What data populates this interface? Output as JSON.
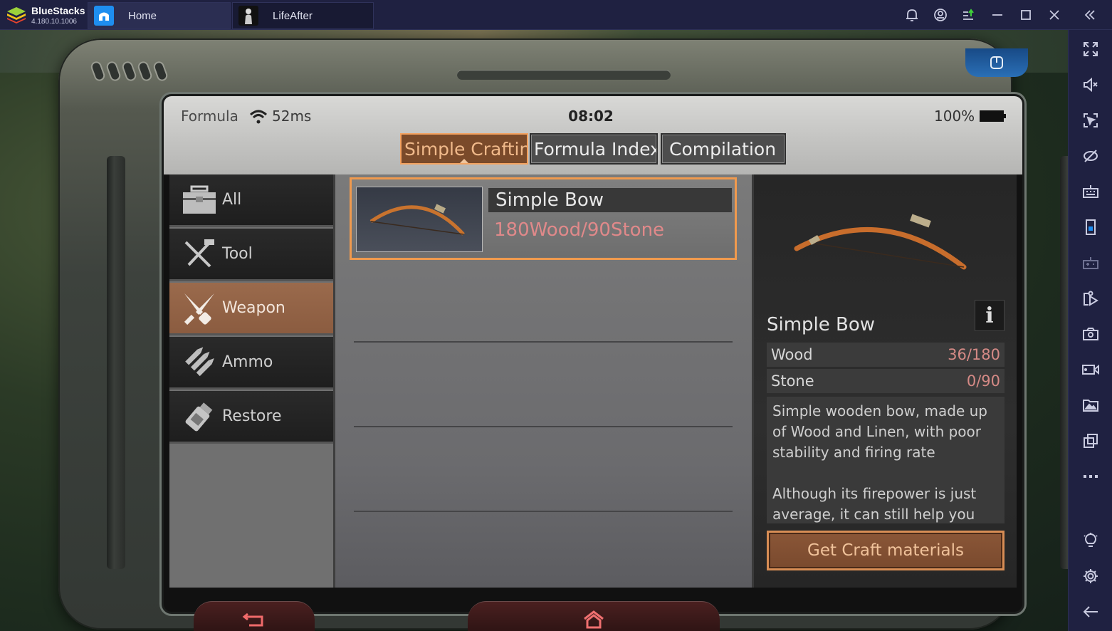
{
  "titlebar": {
    "brand": {
      "name": "BlueStacks",
      "version": "4.180.10.1006"
    },
    "tabs": [
      {
        "label": "Home",
        "icon": "home-icon"
      },
      {
        "label": "LifeAfter",
        "icon": "game-avatar-icon"
      }
    ],
    "buttons": [
      {
        "name": "notification-bell-icon"
      },
      {
        "name": "account-icon"
      },
      {
        "name": "app-updates-icon"
      },
      {
        "name": "minimize-icon"
      },
      {
        "name": "maximize-icon"
      },
      {
        "name": "close-icon"
      },
      {
        "name": "collapse-sidebar-icon"
      }
    ]
  },
  "right_sidebar": [
    {
      "name": "fullscreen-icon"
    },
    {
      "name": "mute-icon"
    },
    {
      "name": "lock-cursor-icon"
    },
    {
      "name": "hide-controls-icon"
    },
    {
      "name": "keyboard-icon"
    },
    {
      "name": "portrait-mode-icon"
    },
    {
      "name": "gamepad-icon"
    },
    {
      "name": "screen-record-icon"
    },
    {
      "name": "screenshot-camera-icon"
    },
    {
      "name": "video-recorder-icon"
    },
    {
      "name": "media-folder-icon"
    },
    {
      "name": "multi-instance-icon"
    },
    {
      "name": "more-icon"
    },
    {
      "name": "lightbulb-icon"
    },
    {
      "name": "settings-gear-icon"
    },
    {
      "name": "back-arrow-icon"
    }
  ],
  "game": {
    "status": {
      "screen_title": "Formula",
      "ping": "52ms",
      "time": "08:02",
      "battery": "100%"
    },
    "tabs": [
      {
        "label": "Simple Crafting",
        "active": true
      },
      {
        "label": "Formula Index",
        "active": false
      },
      {
        "label": "Compilation",
        "active": false
      }
    ],
    "categories": [
      {
        "label": "All",
        "icon": "toolbox-icon",
        "active": false
      },
      {
        "label": "Tool",
        "icon": "pliers-hammer-icon",
        "active": false
      },
      {
        "label": "Weapon",
        "icon": "crossed-knives-icon",
        "active": true
      },
      {
        "label": "Ammo",
        "icon": "bullets-icon",
        "active": false
      },
      {
        "label": "Restore",
        "icon": "medicine-bottle-icon",
        "active": false
      }
    ],
    "recipes": [
      {
        "name": "Simple Bow",
        "cost": "180Wood/90Stone",
        "selected": true
      }
    ],
    "detail": {
      "name": "Simple Bow",
      "info_label": "i",
      "materials": [
        {
          "name": "Wood",
          "qty": "36/180"
        },
        {
          "name": "Stone",
          "qty": "0/90"
        }
      ],
      "description": [
        "Simple wooden bow, made up of Wood and Linen, with poor stability and firing rate",
        "Although its firepower is just average, it can still help you"
      ],
      "craft_button": "Get Craft materials"
    },
    "colors": {
      "accent_orange": "#f09a4e",
      "active_category": "#8b5c40",
      "insufficient_red": "#d58a86"
    }
  }
}
